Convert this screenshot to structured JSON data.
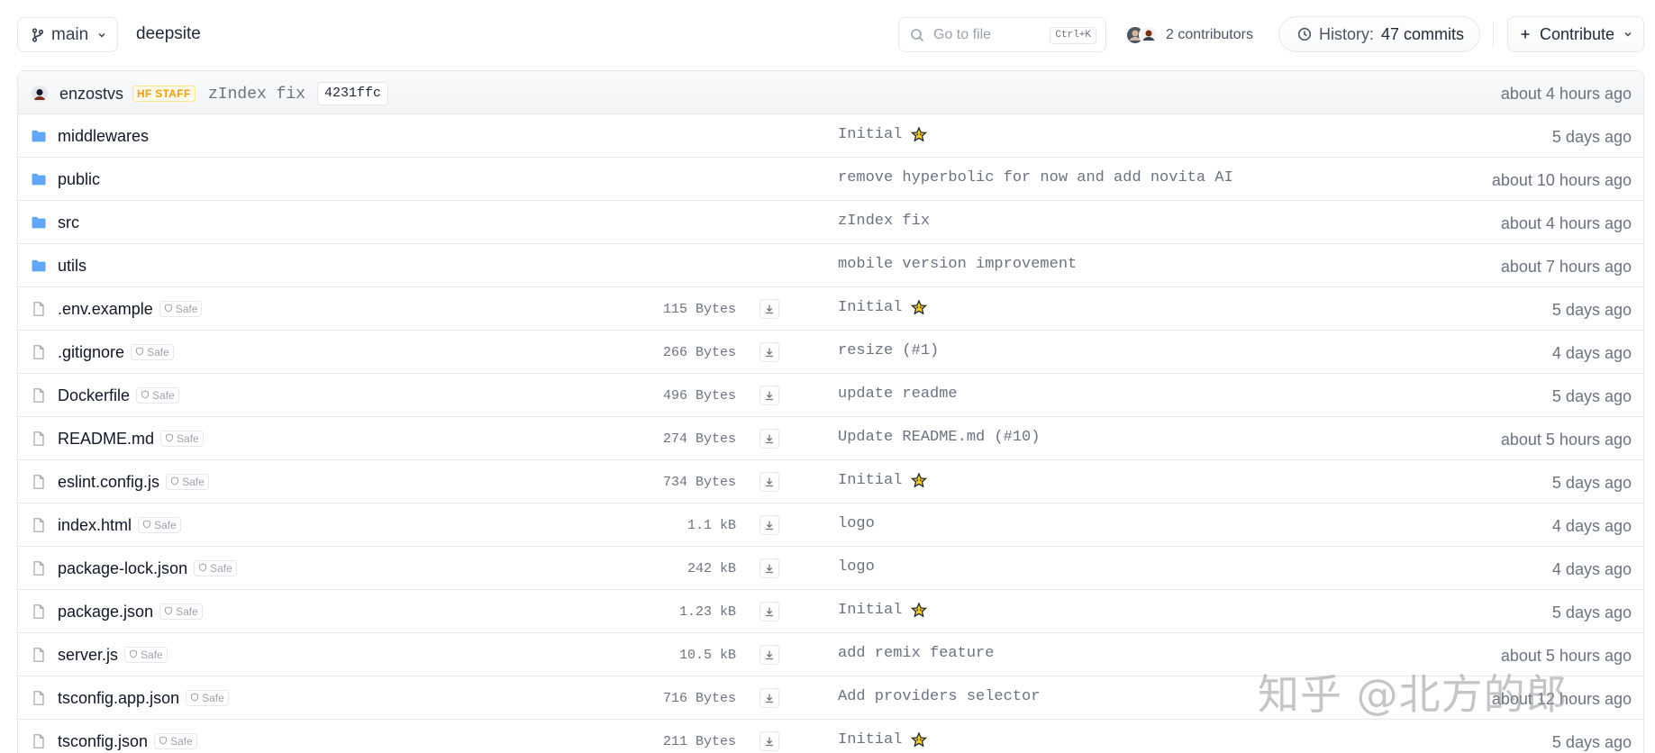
{
  "header": {
    "branch": "main",
    "repo_name": "deepsite",
    "search": {
      "placeholder": "Go to file",
      "shortcut": "Ctrl+K"
    },
    "contributors_label": "2 contributors",
    "history_prefix": "History:",
    "history_count": "47 commits",
    "contribute_label": "Contribute"
  },
  "last_commit": {
    "author": "enzostvs",
    "badge": "HF STAFF",
    "message": "zIndex fix",
    "hash": "4231ffc",
    "time": "about 4 hours ago"
  },
  "files": [
    {
      "type": "folder",
      "name": "middlewares",
      "message": "Initial",
      "emoji": true,
      "time": "5 days ago"
    },
    {
      "type": "folder",
      "name": "public",
      "message": "remove hyperbolic for now and add novita AI",
      "time": "about 10 hours ago"
    },
    {
      "type": "folder",
      "name": "src",
      "message": "zIndex fix",
      "time": "about 4 hours ago"
    },
    {
      "type": "folder",
      "name": "utils",
      "message": "mobile version improvement",
      "time": "about 7 hours ago"
    },
    {
      "type": "file",
      "name": ".env.example",
      "safe": "Safe",
      "size": "115 Bytes",
      "message": "Initial",
      "emoji": true,
      "time": "5 days ago"
    },
    {
      "type": "file",
      "name": ".gitignore",
      "safe": "Safe",
      "size": "266 Bytes",
      "message": "resize (#1)",
      "time": "4 days ago"
    },
    {
      "type": "file",
      "name": "Dockerfile",
      "safe": "Safe",
      "size": "496 Bytes",
      "message": "update readme",
      "time": "5 days ago"
    },
    {
      "type": "file",
      "name": "README.md",
      "safe": "Safe",
      "size": "274 Bytes",
      "message": "Update README.md (#10)",
      "time": "about 5 hours ago"
    },
    {
      "type": "file",
      "name": "eslint.config.js",
      "safe": "Safe",
      "size": "734 Bytes",
      "message": "Initial",
      "emoji": true,
      "time": "5 days ago"
    },
    {
      "type": "file",
      "name": "index.html",
      "safe": "Safe",
      "size": "1.1 kB",
      "message": "logo",
      "time": "4 days ago"
    },
    {
      "type": "file",
      "name": "package-lock.json",
      "safe": "Safe",
      "size": "242 kB",
      "message": "logo",
      "time": "4 days ago"
    },
    {
      "type": "file",
      "name": "package.json",
      "safe": "Safe",
      "size": "1.23 kB",
      "message": "Initial",
      "emoji": true,
      "time": "5 days ago"
    },
    {
      "type": "file",
      "name": "server.js",
      "safe": "Safe",
      "size": "10.5 kB",
      "message": "add remix feature",
      "time": "about 5 hours ago"
    },
    {
      "type": "file",
      "name": "tsconfig.app.json",
      "safe": "Safe",
      "size": "716 Bytes",
      "message": "Add providers selector",
      "time": "about 12 hours ago"
    },
    {
      "type": "file",
      "name": "tsconfig.json",
      "safe": "Safe",
      "size": "211 Bytes",
      "message": "Initial",
      "emoji": true,
      "time": "5 days ago"
    }
  ],
  "watermark": "知乎 @北方的郎",
  "colors": {
    "folder": "#60a5fa",
    "staff_badge": "#f59e0b",
    "muted_text": "#6b7280"
  }
}
